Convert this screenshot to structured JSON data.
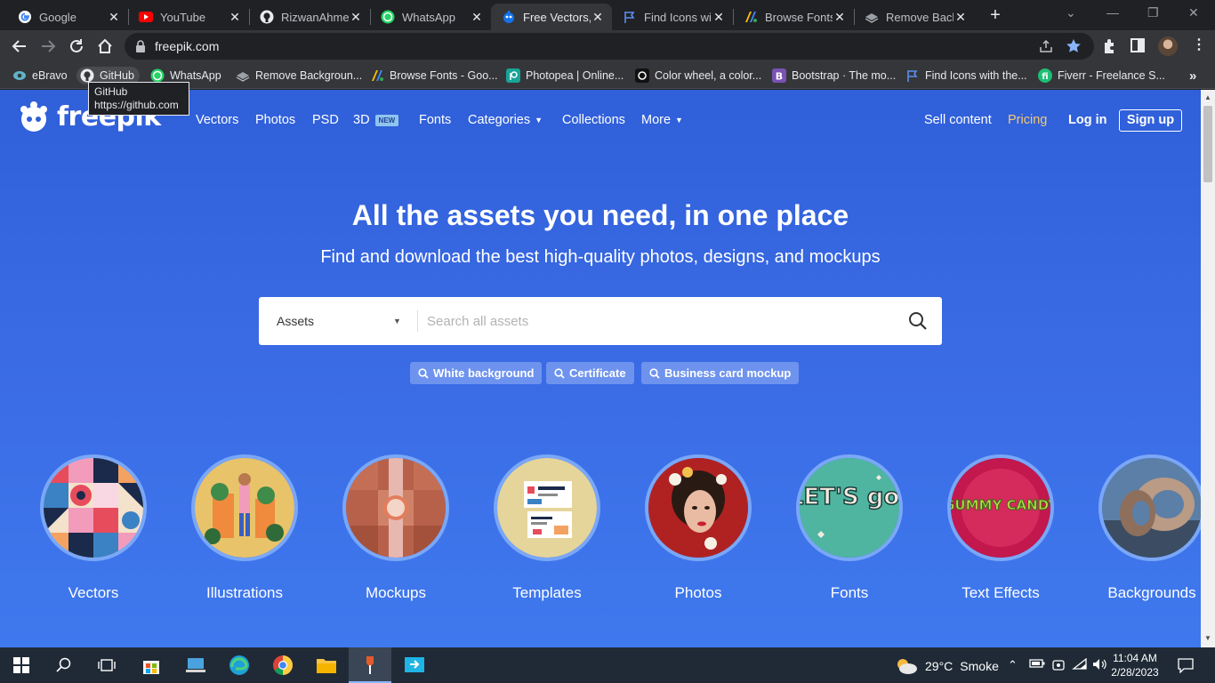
{
  "browser": {
    "tabs": [
      {
        "title": "Google",
        "icon": "google-icon",
        "active": false
      },
      {
        "title": "YouTube",
        "icon": "youtube-icon",
        "active": false
      },
      {
        "title": "RizwanAhmed",
        "icon": "github-icon",
        "active": false
      },
      {
        "title": "WhatsApp",
        "icon": "whatsapp-icon",
        "active": false
      },
      {
        "title": "Free Vectors,",
        "icon": "freepik-icon",
        "active": true
      },
      {
        "title": "Find Icons wit",
        "icon": "flag-icon",
        "active": false
      },
      {
        "title": "Browse Fonts",
        "icon": "google-fonts-icon",
        "active": false
      },
      {
        "title": "Remove Backg",
        "icon": "removebg-icon",
        "active": false
      }
    ],
    "new_tab": "+",
    "url": "freepik.com",
    "bookmarks": [
      {
        "label": "eBravo",
        "icon": "ebravo-icon"
      },
      {
        "label": "GitHub",
        "icon": "github-icon"
      },
      {
        "label": "WhatsApp",
        "icon": "whatsapp-icon"
      },
      {
        "label": "Remove Backgroun...",
        "icon": "removebg-icon"
      },
      {
        "label": "Browse Fonts - Goo...",
        "icon": "google-fonts-icon"
      },
      {
        "label": "Photopea | Online...",
        "icon": "photopea-icon"
      },
      {
        "label": "Color wheel, a color...",
        "icon": "color-wheel-icon"
      },
      {
        "label": "Bootstrap · The mo...",
        "icon": "bootstrap-icon"
      },
      {
        "label": "Find Icons with the...",
        "icon": "flag-icon"
      },
      {
        "label": "Fiverr - Freelance S...",
        "icon": "fiverr-icon"
      }
    ],
    "bookmarks_more": "»",
    "tooltip": {
      "title": "GitHub",
      "url": "https://github.com"
    }
  },
  "site": {
    "logo": "freepik",
    "nav": {
      "vectors": "Vectors",
      "photos": "Photos",
      "psd": "PSD",
      "three_d": "3D",
      "new_badge": "NEW",
      "fonts": "Fonts",
      "categories": "Categories",
      "collections": "Collections",
      "more": "More"
    },
    "right_nav": {
      "sell": "Sell content",
      "pricing": "Pricing",
      "login": "Log in",
      "signup": "Sign up"
    },
    "hero": {
      "title": "All the assets you need, in one place",
      "subtitle": "Find and download the best high-quality photos, designs, and mockups"
    },
    "search": {
      "type_selected": "Assets",
      "placeholder": "Search all assets"
    },
    "suggestions": [
      "White background",
      "Certificate",
      "Business card mockup"
    ],
    "categories": [
      "Vectors",
      "Illustrations",
      "Mockups",
      "Templates",
      "Photos",
      "Fonts",
      "Text Effects",
      "Backgrounds"
    ],
    "category_art": {
      "fonts_lettering": "LET'S go!",
      "text_effects_lettering": "GUMMY CANDY"
    },
    "colors": {
      "brand_blue": "#3a6ae4",
      "pricing": "#f7c873",
      "chip": "#6e93ee"
    }
  },
  "taskbar": {
    "weather": {
      "temp": "29°C",
      "condition": "Smoke"
    },
    "time": "11:04 AM",
    "date": "2/28/2023"
  }
}
